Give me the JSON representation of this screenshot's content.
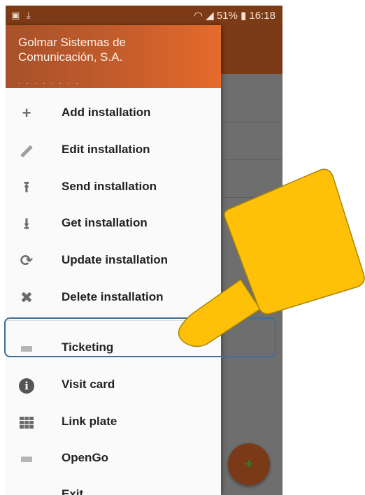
{
  "status_bar": {
    "left_icons": [
      "image-icon",
      "download-icon"
    ],
    "battery_percent": "51%",
    "time": "16:18"
  },
  "drawer": {
    "header_title": "Golmar Sistemas de Comunicación, S.A.",
    "items": [
      {
        "label": "Add installation",
        "icon": "plus-icon"
      },
      {
        "label": "Edit installation",
        "icon": "pencil-icon"
      },
      {
        "label": "Send installation",
        "icon": "upload-icon"
      },
      {
        "label": "Get installation",
        "icon": "download-icon"
      },
      {
        "label": "Update installation",
        "icon": "refresh-icon"
      },
      {
        "label": "Delete installation",
        "icon": "close-icon"
      },
      {
        "label": "Ticketing",
        "icon": "ticket-icon"
      },
      {
        "label": "Visit card",
        "icon": "info-icon"
      },
      {
        "label": "Link plate",
        "icon": "grid-icon"
      },
      {
        "label": "OpenGo",
        "icon": "opengo-icon"
      },
      {
        "label": "Exit",
        "icon": "exit-icon"
      }
    ]
  },
  "fab": {
    "icon": "plus-icon"
  },
  "colors": {
    "status_bar": "#7c3b16",
    "header_gradient_start": "#a7512a",
    "header_gradient_end": "#e66b2c",
    "highlight_outline": "#3f6e9a",
    "pointer_fill": "#ffc107"
  }
}
